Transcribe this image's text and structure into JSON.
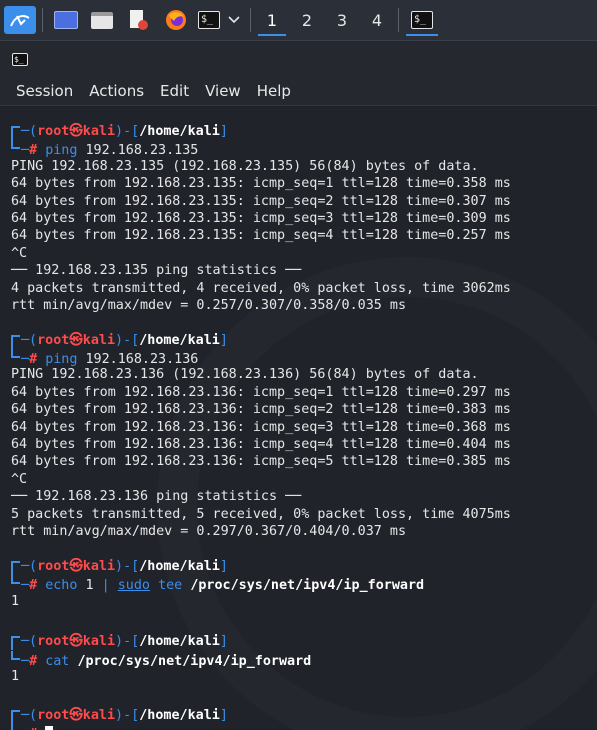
{
  "taskbar": {
    "workspaces": [
      "1",
      "2",
      "3",
      "4"
    ],
    "icons": [
      "kali-menu-icon",
      "show-desktop-icon",
      "file-manager-icon",
      "text-editor-icon",
      "firefox-icon",
      "terminal-icon",
      "chevron-down-icon",
      "terminal-task-icon"
    ],
    "terminal_glyph": "$_"
  },
  "window": {
    "title_icon": "$_",
    "menu": [
      "Session",
      "Actions",
      "Edit",
      "View",
      "Help"
    ]
  },
  "prompt": {
    "user": "root",
    "host": "kali",
    "at": "㉿",
    "dir": "/home/kali",
    "hash": "#"
  },
  "blocks": [
    {
      "cmd": "ping",
      "args": " 192.168.23.135",
      "output": [
        "PING 192.168.23.135 (192.168.23.135) 56(84) bytes of data.",
        "64 bytes from 192.168.23.135: icmp_seq=1 ttl=128 time=0.358 ms",
        "64 bytes from 192.168.23.135: icmp_seq=2 ttl=128 time=0.307 ms",
        "64 bytes from 192.168.23.135: icmp_seq=3 ttl=128 time=0.309 ms",
        "64 bytes from 192.168.23.135: icmp_seq=4 ttl=128 time=0.257 ms",
        "^C",
        "── 192.168.23.135 ping statistics ──",
        "4 packets transmitted, 4 received, 0% packet loss, time 3062ms",
        "rtt min/avg/max/mdev = 0.257/0.307/0.358/0.035 ms"
      ]
    },
    {
      "cmd": "ping",
      "args": " 192.168.23.136",
      "output": [
        "PING 192.168.23.136 (192.168.23.136) 56(84) bytes of data.",
        "64 bytes from 192.168.23.136: icmp_seq=1 ttl=128 time=0.297 ms",
        "64 bytes from 192.168.23.136: icmp_seq=2 ttl=128 time=0.383 ms",
        "64 bytes from 192.168.23.136: icmp_seq=3 ttl=128 time=0.368 ms",
        "64 bytes from 192.168.23.136: icmp_seq=4 ttl=128 time=0.404 ms",
        "64 bytes from 192.168.23.136: icmp_seq=5 ttl=128 time=0.385 ms",
        "^C",
        "── 192.168.23.136 ping statistics ──",
        "5 packets transmitted, 5 received, 0% packet loss, time 4075ms",
        "rtt min/avg/max/mdev = 0.297/0.367/0.404/0.037 ms"
      ]
    }
  ],
  "echo_cmd": {
    "cmd": "echo",
    "arg1": " 1 ",
    "pipe": "|",
    "sudo": "sudo",
    "tee": "tee",
    "path": "/proc/sys/net/ipv4/ip_forward",
    "output": "1"
  },
  "cat_cmd": {
    "cmd": "cat",
    "path": "/proc/sys/net/ipv4/ip_forward",
    "output": "1"
  },
  "colors": {
    "prompt_blue": "#3b8eea",
    "prompt_red": "#ff4b4b",
    "text": "#e6e6e6",
    "background": "#21232b"
  }
}
